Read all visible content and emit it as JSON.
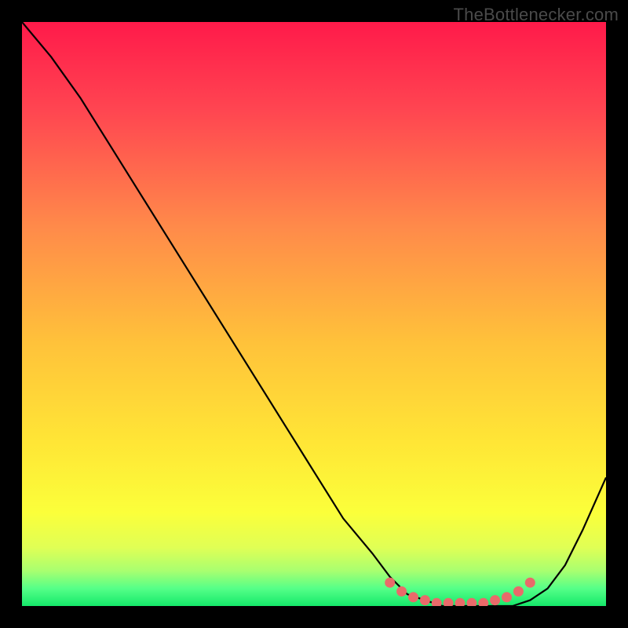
{
  "watermark": "TheBottlenecker.com",
  "chart_data": {
    "type": "line",
    "title": "",
    "xlabel": "",
    "ylabel": "",
    "xlim": [
      0,
      100
    ],
    "ylim": [
      0,
      100
    ],
    "series": [
      {
        "name": "bottleneck-curve",
        "x": [
          0,
          5,
          10,
          15,
          20,
          25,
          30,
          35,
          40,
          45,
          50,
          55,
          60,
          63,
          66,
          69,
          72,
          75,
          78,
          81,
          84,
          87,
          90,
          93,
          96,
          100
        ],
        "y": [
          100,
          94,
          87,
          79,
          71,
          63,
          55,
          47,
          39,
          31,
          23,
          15,
          9,
          5,
          2,
          1,
          0,
          0,
          0,
          0,
          0,
          1,
          3,
          7,
          13,
          22
        ]
      }
    ],
    "highlight": {
      "name": "optimal-range-markers",
      "x": [
        63,
        65,
        67,
        69,
        71,
        73,
        75,
        77,
        79,
        81,
        83,
        85,
        87
      ],
      "y": [
        4,
        2.5,
        1.5,
        1,
        0.5,
        0.5,
        0.5,
        0.5,
        0.5,
        1,
        1.5,
        2.5,
        4
      ]
    },
    "gradient_stops": [
      {
        "pos": 0.0,
        "color": "#ff1a4a"
      },
      {
        "pos": 0.15,
        "color": "#ff4551"
      },
      {
        "pos": 0.35,
        "color": "#ff8a4a"
      },
      {
        "pos": 0.55,
        "color": "#ffc23a"
      },
      {
        "pos": 0.72,
        "color": "#ffe636"
      },
      {
        "pos": 0.84,
        "color": "#fbff3a"
      },
      {
        "pos": 0.9,
        "color": "#e0ff55"
      },
      {
        "pos": 0.94,
        "color": "#a8ff70"
      },
      {
        "pos": 0.97,
        "color": "#55ff88"
      },
      {
        "pos": 1.0,
        "color": "#15e86a"
      }
    ]
  }
}
